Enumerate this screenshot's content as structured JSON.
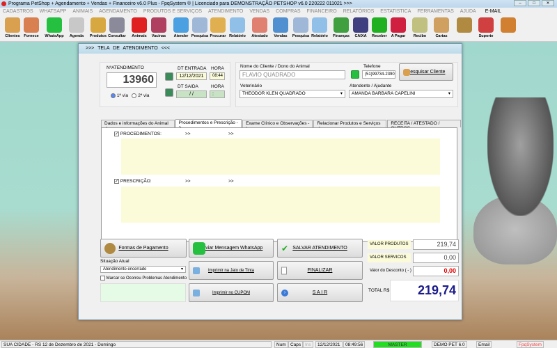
{
  "window_title": "Programa PetShop + Agendamento + Vendas + Financeiro v6.0 Plus - FpqSystem ® | Licenciado para  DEMONSTRAÇÃO PETSHOP v6.0 220222 011021 >>>",
  "menu": [
    "CADASTROS",
    "WHATSAPP",
    "ANIMAIS",
    "AGENDAMENTO",
    "PRODUTOS E SERVIÇOS",
    "ATENDIMENTO",
    "VENDAS",
    "COMPRAS",
    "FINANCEIRO",
    "RELATÓRIOS",
    "ESTATISTICA",
    "FERRAMENTAS",
    "AJUDA"
  ],
  "menu_email": "E-MAIL",
  "toolbar": [
    {
      "label": "Clientes",
      "icon": "clients-icon",
      "color": "#d9a050"
    },
    {
      "label": "Fornece",
      "icon": "supplier-icon",
      "color": "#d98050"
    },
    {
      "label": "WhatsApp",
      "icon": "whatsapp-icon",
      "color": "#25c040"
    },
    {
      "label": "Agenda",
      "icon": "agenda-icon",
      "color": "#c8c8c8"
    },
    {
      "label": "Produtos",
      "icon": "products-icon",
      "color": "#d8a840"
    },
    {
      "label": "Consultar",
      "icon": "barcode-icon",
      "color": "#8a8a9a"
    },
    {
      "label": "Animais",
      "icon": "paw-icon",
      "color": "#e02020"
    },
    {
      "label": "Vacinas",
      "icon": "vaccine-icon",
      "color": "#b04060"
    },
    {
      "label": "Atender",
      "icon": "paw-plus-icon",
      "color": "#4aa0e0"
    },
    {
      "label": "Pesquisa",
      "icon": "search-doc-icon",
      "color": "#a0b8d8"
    },
    {
      "label": "Procurar",
      "icon": "folder-icon",
      "color": "#e0b050"
    },
    {
      "label": "Relatório",
      "icon": "printer-icon",
      "color": "#90c0e8"
    },
    {
      "label": "Atestado",
      "icon": "certificate-icon",
      "color": "#e08070"
    },
    {
      "label": "Vendas",
      "icon": "monitor-icon",
      "color": "#5090d0"
    },
    {
      "label": "Pesquisa",
      "icon": "search-doc-icon",
      "color": "#a0b8d8"
    },
    {
      "label": "Relatório",
      "icon": "printer-icon",
      "color": "#90c0e8"
    },
    {
      "label": "Finanças",
      "icon": "finance-icon",
      "color": "#40a040"
    },
    {
      "label": "CAIXA",
      "icon": "cashbook-icon",
      "color": "#404080"
    },
    {
      "label": "Receber",
      "icon": "receive-icon",
      "color": "#20b020"
    },
    {
      "label": "A Pagar",
      "icon": "pay-icon",
      "color": "#d02040"
    },
    {
      "label": "Recibo",
      "icon": "receipt-icon",
      "color": "#c0c080"
    },
    {
      "label": "Cartas",
      "icon": "scroll-icon",
      "color": "#d0a060"
    },
    {
      "label": "",
      "icon": "coins-icon",
      "color": "#b08a40"
    },
    {
      "label": "Suporte",
      "icon": "support-icon",
      "color": "#d04040"
    },
    {
      "label": "",
      "icon": "exit-icon",
      "color": "#d08030"
    }
  ],
  "form": {
    "title": ">>>   TELA DE ATENDIMENTO   <<<",
    "num_label": "NºATENDIMENTO",
    "num_value": "13960",
    "via1": "1ª via",
    "via2": "2ª via",
    "dt_entrada_label": "DT ENTRADA",
    "dt_entrada": "12/12/2021",
    "hora_label": "HORA",
    "hora_entrada": "08:44",
    "dt_saida_label": "DT SAIDA",
    "dt_saida": " / /",
    "hora_saida": " : ",
    "cliente_label": "Nome do Cliente / Dono do Animal",
    "cliente": "FLAVIO QUADRADO",
    "telefone_label": "Telefone",
    "telefone": "(51)99734-2390",
    "pesquisar_cliente": "Pesquisar Cliente",
    "veterinario_label": "Veterinário",
    "veterinario": "THEODOR KLEN QUADRADO",
    "atendente_label": "Atendente / Ajudante",
    "atendente": "AMANDA BARBARA CAPELINI"
  },
  "tabs": [
    "Dados e informações do Animal ->",
    "Procedimentos e Prescrição ->",
    "Exame Clínico e Observações ->",
    "Relacionar Produtos e Serviços ->",
    "RECEITA / ATESTADO / OUTROS"
  ],
  "panel": {
    "procedimentos": "PROCEDIMENTOS:",
    "prescricao": "PRESCRIÇÃO:",
    "arrows": ">>"
  },
  "bottom": {
    "formas_pagamento": "Formas de Pagamento",
    "enviar_whatsapp": "Enviar Mensagem WhatsApp",
    "salvar": "SALVAR  ATENDIMENTO",
    "situacao_label": "Situação Atual",
    "situacao": "Atendimento encerrado",
    "imprimir_jato": "Imprimir na Jato de Tinta",
    "finalizar": "FINALIZAR",
    "marcar_problemas": "Marcar se Ocorreu Problemas Atendimento",
    "imprimir_cupom": "Imprimir no CUPOM",
    "sair": "S A I R",
    "valor_produtos_label": "VALOR PRODUTOS",
    "valor_produtos": "219,74",
    "valor_servicos_label": "VALOR SERVICOS",
    "valor_servicos": "0,00",
    "desconto_label": "Valor do Desconto ( - )",
    "desconto": "0,00",
    "total_label": "TOTAL R$",
    "total": "219,74"
  },
  "statusbar": {
    "location": "SUA CIDADE - RS 12 de Dezembro de 2021 - Domingo",
    "num": "Num",
    "caps": "Caps",
    "ins": "Ins",
    "date": "12/12/2021",
    "time": "08:49:56",
    "user": "MASTER",
    "version": "DEMO PET 6.0",
    "email": "Email",
    "brand": "FpqSystem"
  },
  "colors": {
    "accent_green": "#22dd22",
    "total_blue": "#1a1a8c",
    "discount_red": "#e00000",
    "highlight_yellow": "#fbfbd9"
  }
}
